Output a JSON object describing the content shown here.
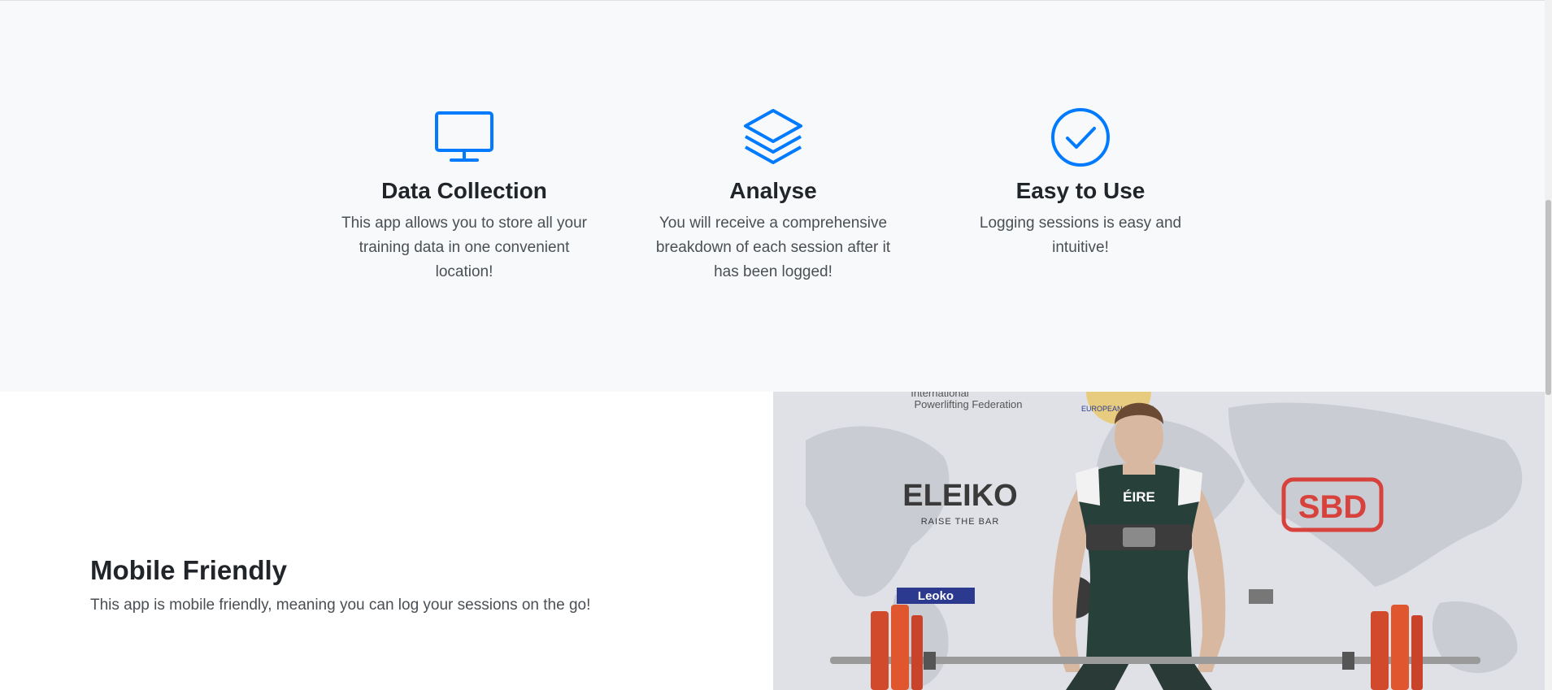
{
  "colors": {
    "accent": "#007bff",
    "section_bg": "#f8f9fa",
    "heading": "#212529",
    "body_text": "#4a4f54"
  },
  "features": [
    {
      "icon": "desktop-monitor-icon",
      "title": "Data Collection",
      "text": "This app allows you to store all your training data in one convenient location!"
    },
    {
      "icon": "layers-icon",
      "title": "Analyse",
      "text": "You will receive a comprehensive breakdown of each session after it has been logged!"
    },
    {
      "icon": "check-circle-icon",
      "title": "Easy to Use",
      "text": "Logging sessions is easy and intuitive!"
    }
  ],
  "showcase": {
    "title": "Mobile Friendly",
    "text": "This app is mobile friendly, meaning you can log your sessions on the go!",
    "image": {
      "banner_top_left": "International",
      "banner_top_left_2": "Powerlifting Federation",
      "banner_top_center": "EUROPEAN POWERL",
      "sponsor_1": "ELEIKO",
      "sponsor_1_tag": "RAISE THE BAR",
      "sponsor_2": "SBD",
      "sponsor_3": "Leoko",
      "singlet_text": "ÉIRE"
    }
  }
}
